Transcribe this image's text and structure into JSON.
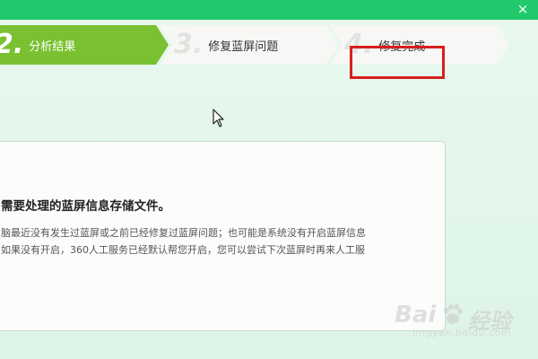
{
  "window": {
    "close_glyph": "×"
  },
  "steps": [
    {
      "number": "2.",
      "label": "分析结果",
      "state": "active"
    },
    {
      "number": "3.",
      "label": "修复蓝屏问题",
      "state": "pending"
    },
    {
      "number": "4.",
      "label": "修复完成",
      "state": "pending"
    }
  ],
  "panel": {
    "heading": "需要处理的蓝屏信息存储文件。",
    "line1": "脑最近没有发生过蓝屏或之前已经修复过蓝屏问题；也可能是系统没有开启蓝屏信息",
    "line2": "如果没有开启，360人工服务已经默认帮您开启，您可以尝试下次蓝屏时再来人工服"
  },
  "watermark": {
    "left": "Bai",
    "right": "经验",
    "sub": "jingyan.baidu.com"
  },
  "colors": {
    "titlebar": "#22c96c",
    "active_step": "#79c130",
    "highlight": "#d81e1e",
    "background": "#e3f6ec"
  }
}
